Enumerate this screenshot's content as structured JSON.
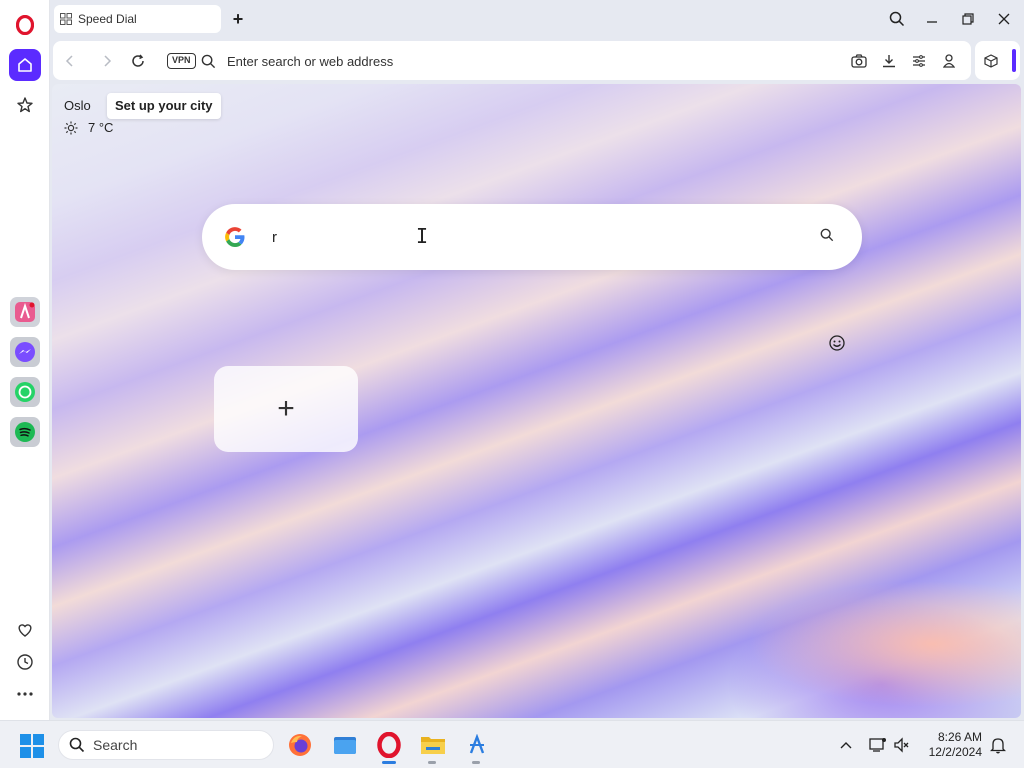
{
  "tab": {
    "label": "Speed Dial"
  },
  "toolbar": {
    "vpn_label": "VPN",
    "address_placeholder": "Enter search or web address"
  },
  "weather": {
    "city": "Oslo",
    "setup_label": "Set up your city",
    "temperature": "7 °C"
  },
  "search": {
    "value": "r"
  },
  "speed_dial": {
    "add_label": "+"
  },
  "taskbar": {
    "search_label": "Search",
    "time": "8:26 AM",
    "date": "12/2/2024"
  },
  "colors": {
    "opera_red": "#e0142d",
    "accent": "#5b2bff",
    "sidebar_active": "#5b2bff"
  }
}
